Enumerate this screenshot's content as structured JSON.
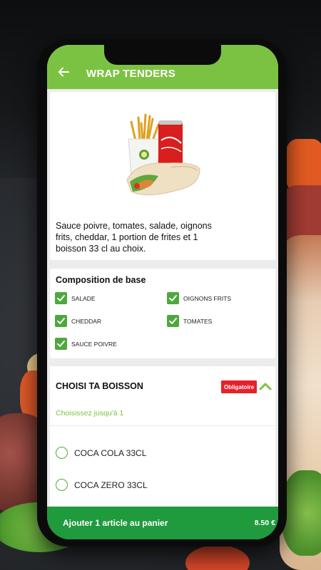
{
  "header": {
    "title": "WRAP TENDERS",
    "back_icon": "arrow-left-icon"
  },
  "product": {
    "image_icon": "wrap-menu-photo",
    "description": "Sauce poivre, tomates, salade, oignons frits, cheddar, 1 portion de frites et 1 boisson 33 cl au choix."
  },
  "composition": {
    "title": "Composition de base",
    "items": [
      {
        "label": "SALADE",
        "checked": true
      },
      {
        "label": "OIGNONS FRITS",
        "checked": true
      },
      {
        "label": "CHEDDAR",
        "checked": true
      },
      {
        "label": "TOMATES",
        "checked": true
      },
      {
        "label": "SAUCE POIVRE",
        "checked": true
      }
    ]
  },
  "drinks": {
    "title": "CHOISI TA BOISSON",
    "badge": "Obligatoire",
    "limit": "Choisissez jusqu'à 1",
    "options": [
      {
        "label": "COCA COLA 33CL",
        "selected": false
      },
      {
        "label": "COCA ZERO 33CL",
        "selected": false
      }
    ]
  },
  "cart": {
    "label": "Ajouter 1 article au panier",
    "price": "8.50 €"
  },
  "colors": {
    "header": "#7cc242",
    "check": "#4fa83d",
    "badge": "#e8202a",
    "cart": "#1f9a3d"
  }
}
